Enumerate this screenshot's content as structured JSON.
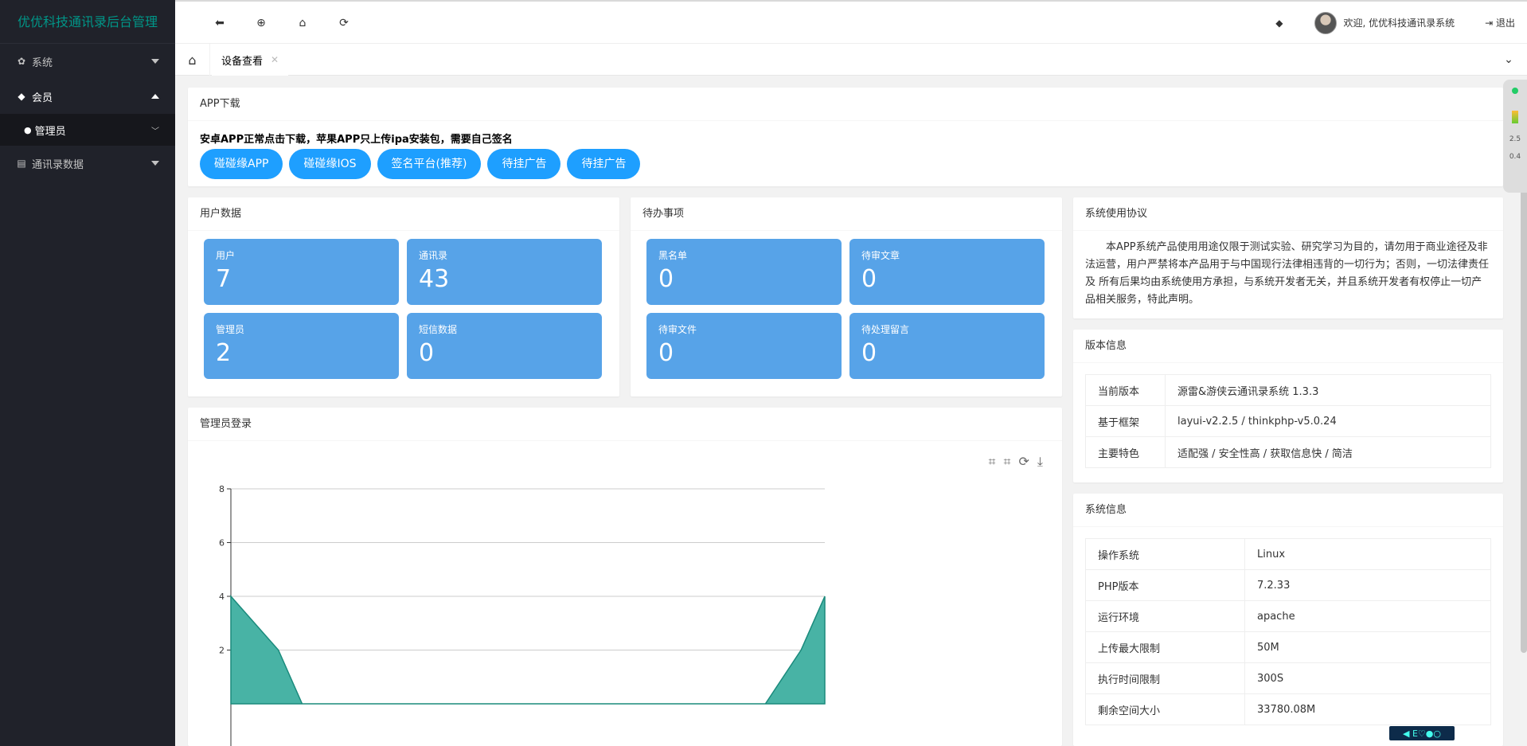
{
  "app": {
    "title": "优优科技通讯录后台管理"
  },
  "sidebar": {
    "items": [
      {
        "icon": "gear-icon",
        "glyph": "✿",
        "label": "系统",
        "expanded": false
      },
      {
        "icon": "users-icon",
        "glyph": "👥",
        "label": "会员",
        "expanded": true
      },
      {
        "icon": "address-card-icon",
        "glyph": "▤",
        "label": "通讯录数据",
        "expanded": false
      }
    ],
    "sub_items": [
      {
        "icon": "user-icon",
        "glyph": "👤",
        "label": "管理员"
      }
    ]
  },
  "header": {
    "tools": [
      {
        "name": "back-icon",
        "glyph": "🡐"
      },
      {
        "name": "crosshair-icon",
        "glyph": "⊕"
      },
      {
        "name": "bank-icon",
        "glyph": "🏛"
      },
      {
        "name": "refresh-icon",
        "glyph": "⟳"
      }
    ],
    "welcome": "欢迎, 优优科技通讯录系统",
    "logout": "退出"
  },
  "tabs": {
    "active": "设备查看"
  },
  "app_download": {
    "title": "APP下载",
    "notice": "安卓APP正常点击下载，苹果APP只上传ipa安装包，需要自己签名",
    "buttons": [
      "碰碰缘APP",
      "碰碰缘IOS",
      "签名平台(推荐)",
      "待挂广告",
      "待挂广告"
    ]
  },
  "user_data": {
    "title": "用户数据",
    "stats": [
      {
        "label": "用户",
        "value": "7"
      },
      {
        "label": "通讯录",
        "value": "43"
      },
      {
        "label": "管理员",
        "value": "2"
      },
      {
        "label": "短信数据",
        "value": "0"
      }
    ]
  },
  "todo": {
    "title": "待办事项",
    "stats": [
      {
        "label": "黑名单",
        "value": "0"
      },
      {
        "label": "待审文章",
        "value": "0"
      },
      {
        "label": "待审文件",
        "value": "0"
      },
      {
        "label": "待处理留言",
        "value": "0"
      }
    ]
  },
  "agreement": {
    "title": "系统使用协议",
    "text": "本APP系统产品使用用途仅限于测试实验、研究学习为目的，请勿用于商业途径及非法运营，用户严禁将本产品用于与中国现行法律相违背的一切行为；否则，一切法律责任 及 所有后果均由系统使用方承担，与系统开发者无关，并且系统开发者有权停止一切产品相关服务，特此声明。"
  },
  "version": {
    "title": "版本信息",
    "rows": [
      {
        "key": "当前版本",
        "value": "源雷&游侠云通讯录系统 1.3.3"
      },
      {
        "key": "基于框架",
        "value": "layui-v2.2.5 / thinkphp-v5.0.24"
      },
      {
        "key": "主要特色",
        "value": "适配强 / 安全性高 / 获取信息快 / 简洁"
      }
    ]
  },
  "sysinfo": {
    "title": "系统信息",
    "rows": [
      {
        "key": "操作系统",
        "value": "Linux"
      },
      {
        "key": "PHP版本",
        "value": "7.2.33"
      },
      {
        "key": "运行环境",
        "value": "apache"
      },
      {
        "key": "上传最大限制",
        "value": "50M"
      },
      {
        "key": "执行时间限制",
        "value": "300S"
      },
      {
        "key": "剩余空间大小",
        "value": "33780.08M"
      }
    ]
  },
  "admin_login": {
    "title": "管理员登录"
  },
  "chart_data": {
    "type": "area",
    "title": "",
    "xlabel": "",
    "ylabel": "",
    "ylim": [
      0,
      8
    ],
    "yticks": [
      "2",
      "4",
      "6",
      "8"
    ],
    "color": "#48b3a5",
    "series": [
      {
        "x": [
          0,
          0.08,
          0.12,
          0.9,
          0.96,
          1
        ],
        "values": [
          4,
          2,
          0,
          0,
          2,
          4
        ]
      }
    ]
  },
  "side_widget": {
    "up": "2.5",
    "down": "0.4"
  }
}
